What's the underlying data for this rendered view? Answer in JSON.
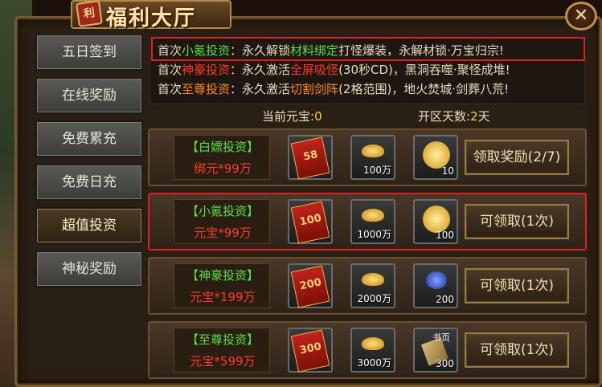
{
  "header": {
    "title": "福利大厅",
    "seal": "利",
    "close_label": "✕"
  },
  "sidebar": {
    "items": [
      {
        "label": "五日签到",
        "active": false
      },
      {
        "label": "在线奖励",
        "active": false
      },
      {
        "label": "免费累充",
        "active": false
      },
      {
        "label": "免费日充",
        "active": false
      },
      {
        "label": "超值投资",
        "active": true
      },
      {
        "label": "神秘奖励",
        "active": false
      }
    ]
  },
  "info": {
    "line1": {
      "p1": "首次",
      "name": "小氪投资",
      "p2": "：永久解锁",
      "hl": "材料绑定",
      "p3": "打怪爆装，永解材锁·万宝归宗!"
    },
    "line2": {
      "p1": "首次",
      "name": "神豪投资",
      "p2": "：永久激活",
      "hl": "全屏吸怪",
      "p3": "(30秒CD)，黑洞吞噬·聚怪成堆!"
    },
    "line3": {
      "p1": "首次",
      "name": "至尊投资",
      "p2": "：永久激活",
      "hl": "切割剑阵",
      "p3": "(2格范围)，地火焚城·剑葬八荒!"
    }
  },
  "stats": {
    "yuanbao_label": "当前元宝:",
    "yuanbao_value": "0",
    "days_label": "开区天数:",
    "days_value": "2",
    "days_unit": "天"
  },
  "rows": [
    {
      "name": "【白嫖投资】",
      "cost": "绑元*99万",
      "pack": "58",
      "ingot": "100万",
      "reward": "10",
      "reward_kind": "coin",
      "action": "领取奖励(2/7)"
    },
    {
      "name": "【小氪投资】",
      "cost": "元宝*99万",
      "pack": "100",
      "ingot": "1000万",
      "reward": "100",
      "reward_kind": "coin",
      "action": "可领取(1次)"
    },
    {
      "name": "【神豪投资】",
      "cost": "元宝*199万",
      "pack": "200",
      "ingot": "2000万",
      "reward": "200",
      "reward_kind": "gem",
      "action": "可领取(1次)"
    },
    {
      "name": "【至尊投资】",
      "cost": "元宝*599万",
      "pack": "300",
      "ingot": "3000万",
      "reward": "300",
      "reward_kind": "book",
      "reward_label": "书页",
      "action": "可领取(1次)"
    }
  ],
  "colors": {
    "highlight_border": "#e02020",
    "green": "#58e040",
    "red": "#ff3a2a",
    "orange": "#ff8a20"
  }
}
